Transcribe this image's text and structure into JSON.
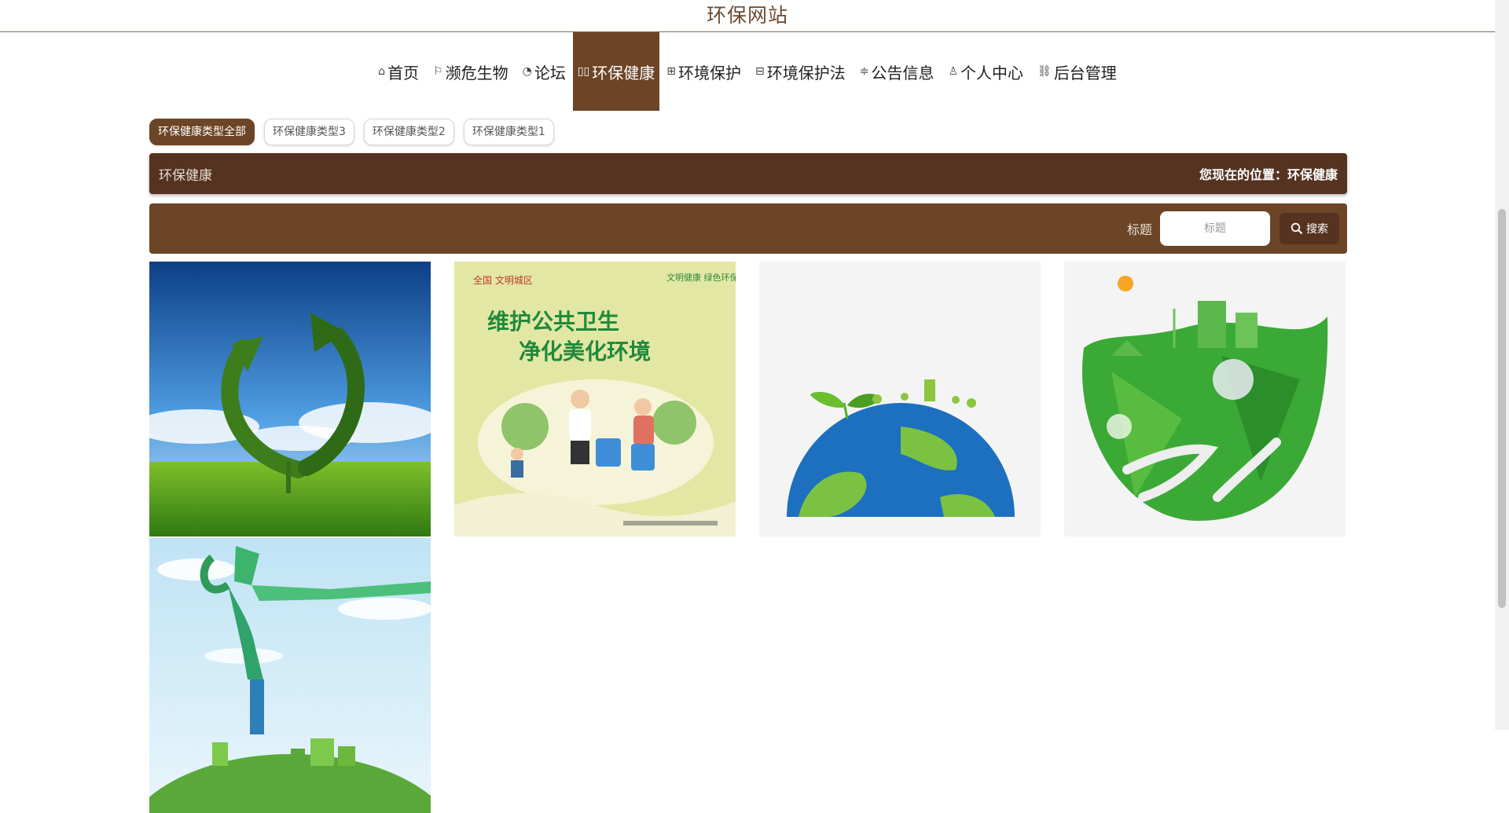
{
  "site": {
    "title": "环保网站"
  },
  "nav": [
    {
      "label": "首页",
      "icon": "home-icon"
    },
    {
      "label": "濒危生物",
      "icon": "flag-icon"
    },
    {
      "label": "论坛",
      "icon": "gauge-icon"
    },
    {
      "label": "环保健康",
      "icon": "book-icon",
      "active": true
    },
    {
      "label": "环境保护",
      "icon": "grid-icon"
    },
    {
      "label": "环境保护法",
      "icon": "table-icon"
    },
    {
      "label": "公告信息",
      "icon": "sliders-icon"
    },
    {
      "label": "个人中心",
      "icon": "user-icon"
    },
    {
      "label": "后台管理",
      "icon": "link-icon"
    }
  ],
  "filters": [
    {
      "label": "环保健康类型全部",
      "active": true
    },
    {
      "label": "环保健康类型3"
    },
    {
      "label": "环保健康类型2"
    },
    {
      "label": "环保健康类型1"
    }
  ],
  "title_bar": {
    "title": "环保健康",
    "location": "您现在的位置：环保健康"
  },
  "search": {
    "label": "标题",
    "placeholder": "标题",
    "button": "搜索"
  },
  "poster": {
    "line1": "维护公共卫生",
    "line2": "净化美化环境",
    "tag_left": "全国 文明城区",
    "tag_right": "文明健康 绿色环保"
  },
  "colors": {
    "brown": "#6b4526",
    "dark_brown": "#553320",
    "title_brown": "#6b4a2f"
  }
}
